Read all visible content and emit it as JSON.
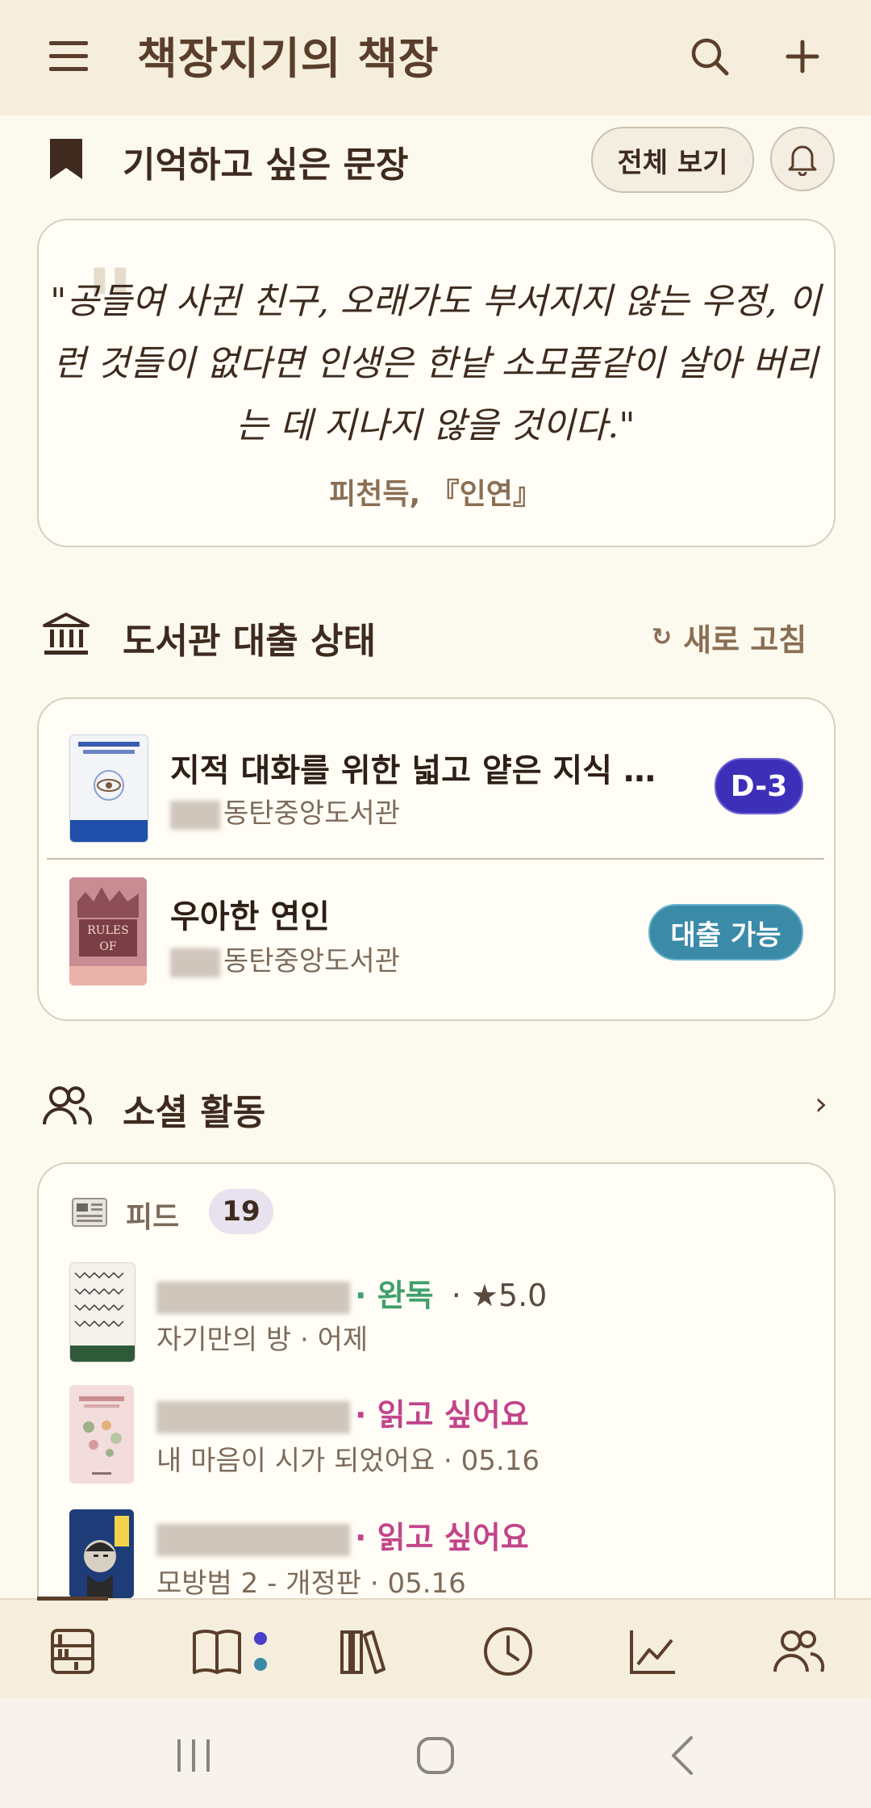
{
  "app_bar": {
    "title": "책장지기의 책장"
  },
  "quote_section": {
    "title": "기억하고 싶은 문장",
    "view_all_label": "전체 보기",
    "quote_text": "\"공들여 사귄 친구, 오래가도 부서지지 않는 우정, 이런 것들이 없다면 인생은 한낱 소모품같이 살아 버리는 데 지나지 않을 것이다.\"",
    "quote_source": "피천득, 『인연』"
  },
  "library_section": {
    "title": "도서관 대출 상태",
    "refresh_label": "새로 고침",
    "refresh_icon": "↻",
    "items": [
      {
        "title": "지적 대화를 위한 넓고 얕은 지식 …",
        "library": "동탄중앙도서관",
        "badge": "D-3",
        "badge_color": "#3D2FB8"
      },
      {
        "title": "우아한 연인",
        "library": "동탄중앙도서관",
        "badge": "대출 가능",
        "badge_color": "#3A8AA8"
      }
    ]
  },
  "social_section": {
    "title": "소셜 활동",
    "chevron": "›",
    "feed_label": "피드",
    "feed_count": "19",
    "feed_items": [
      {
        "status": "· 완독",
        "status_color": "#3FA06A",
        "rating": "· ★5.0",
        "book": "자기만의 방",
        "date": "어제"
      },
      {
        "status": "· 읽고 싶어요",
        "status_color": "#C2448A",
        "rating": "",
        "book": "내 마음이 시가 되었어요",
        "date": "05.16"
      },
      {
        "status": "· 읽고 싶어요",
        "status_color": "#C2448A",
        "rating": "",
        "book": "모방범 2 - 개정판",
        "date": "05.16"
      }
    ]
  },
  "colors": {
    "background": "#FCF9EE",
    "app_bar": "#F5EEDD",
    "accent_brown": "#5A3E2B"
  }
}
